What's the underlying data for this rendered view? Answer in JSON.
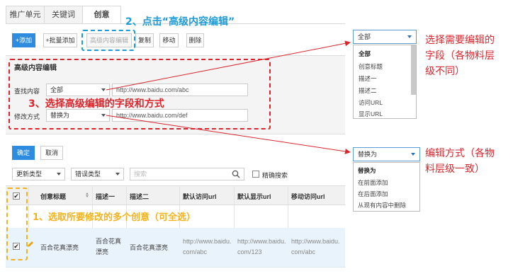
{
  "tabs": [
    "推广单元",
    "关键词",
    "创意"
  ],
  "toolbar": {
    "add": "+添加",
    "batch_add": "+批量添加",
    "advanced_edit": "高级内容编辑",
    "copy": "复制",
    "move": "移动",
    "delete": "删除"
  },
  "panel": {
    "title": "高级内容编辑",
    "find_label": "查找内容",
    "find_field_value": "全部",
    "find_text": "http://www.baidu.com/abc",
    "mode_label": "修改方式",
    "mode_value": "替换为",
    "mode_text": "http://www.baidu.com/def"
  },
  "actions": {
    "confirm": "确定",
    "cancel": "取消"
  },
  "filters": {
    "update_type": "更新类型",
    "error_type": "错误类型",
    "search_placeholder": "搜索",
    "exact_search": "精确搜索"
  },
  "table": {
    "headers": [
      "创意标题",
      "描述一",
      "描述二",
      "默认访问url",
      "默认显示url",
      "移动访问url"
    ],
    "row": {
      "title": "百合花真漂亮",
      "desc1": "百合花真漂亮",
      "desc2": "百合花真漂亮",
      "visit_url": "http://www.baidu.com/abc",
      "display_url": "http://www.baidu.com/123",
      "mobile_url": "http://www.baidu.com/abc"
    }
  },
  "annotations": {
    "step1": "1、选取所要修改的多个创意（可全选）",
    "step2": "2、点击“高级内容编辑”",
    "step3": "3、选择高级编辑的字段和方式",
    "note_field": [
      "选择需要编辑的",
      "字段（各物料层",
      "级不同）"
    ],
    "note_mode": [
      "编辑方式（各物",
      "料层级一致）"
    ]
  },
  "field_dropdown": {
    "selected": "全部",
    "options": [
      "全部",
      "创意标题",
      "描述一",
      "描述二",
      "访问URL",
      "显示URL"
    ]
  },
  "mode_dropdown": {
    "selected": "替换为",
    "options": [
      "替换为",
      "在前面添加",
      "在后面添加",
      "从现有内容中删除"
    ]
  },
  "colors": {
    "accent": "#2d8cdf",
    "annotation_red": "#d9262c",
    "annotation_blue": "#1d9bd7",
    "annotation_yellow": "#f2b21b"
  }
}
